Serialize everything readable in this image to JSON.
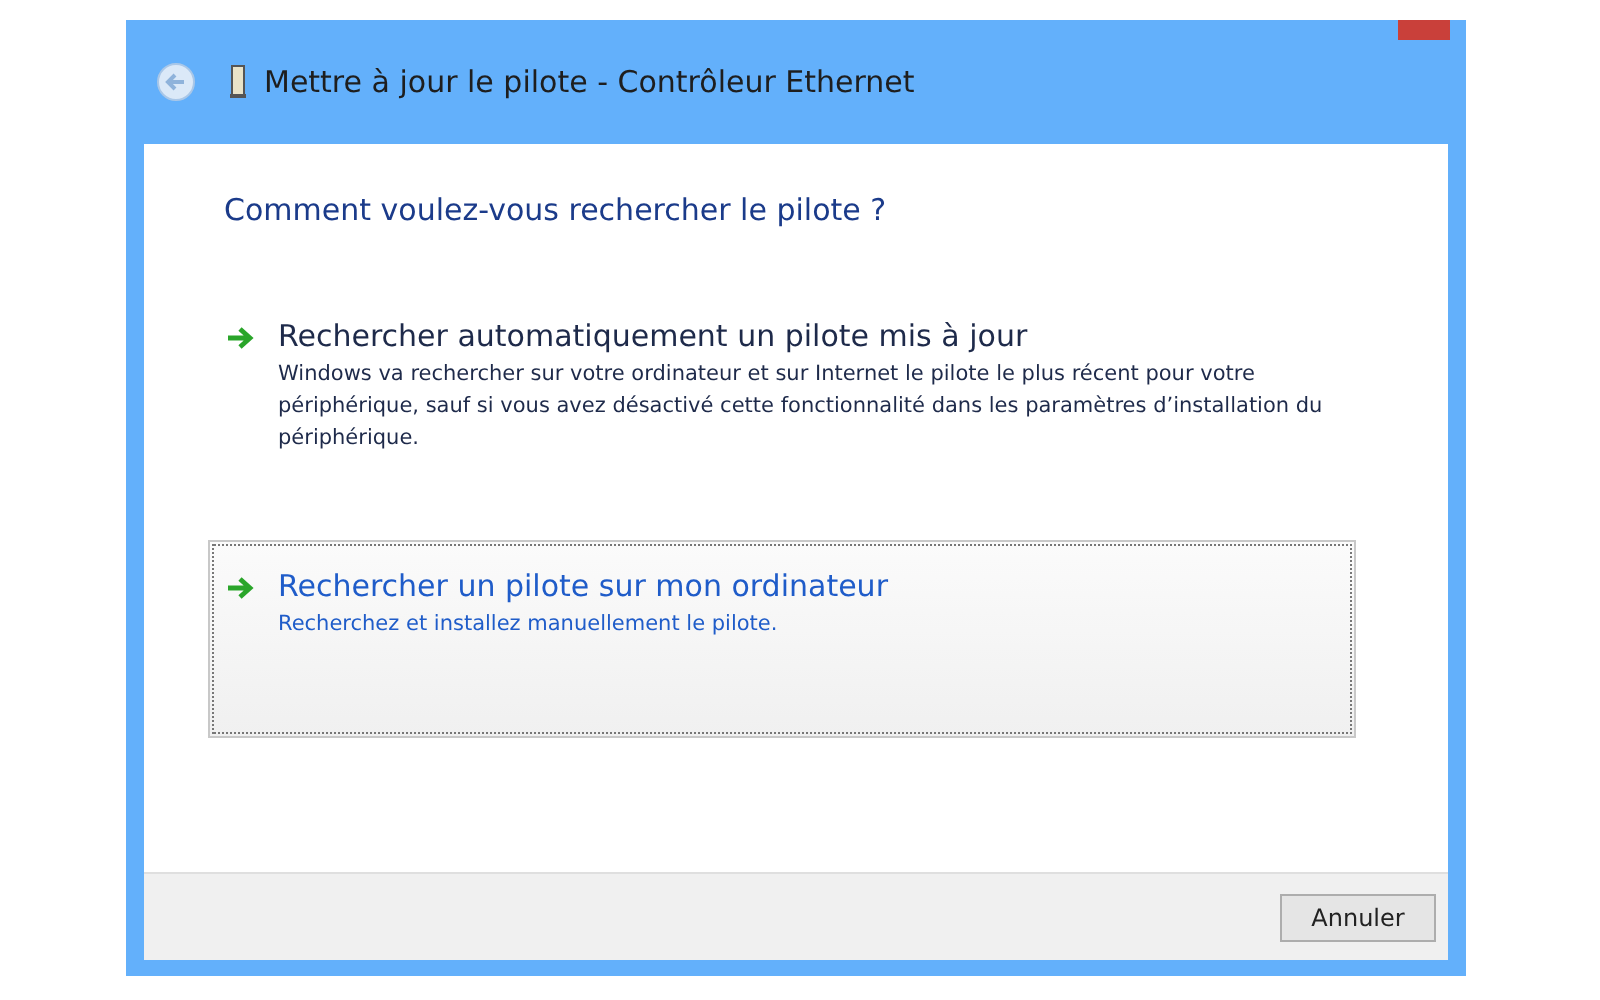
{
  "window": {
    "title": "Mettre à jour le pilote - Contrôleur Ethernet"
  },
  "heading": "Comment voulez-vous rechercher le pilote ?",
  "options": [
    {
      "title": "Rechercher automatiquement un pilote mis à jour",
      "description": "Windows va rechercher sur votre ordinateur et sur Internet le pilote le plus récent pour votre périphérique, sauf si vous avez désactivé cette fonctionnalité dans les paramètres d’installation du périphérique.",
      "selected": false
    },
    {
      "title": "Rechercher un pilote sur mon ordinateur",
      "description": "Recherchez et installez manuellement le pilote.",
      "selected": true
    }
  ],
  "buttons": [
    "Annuler"
  ]
}
